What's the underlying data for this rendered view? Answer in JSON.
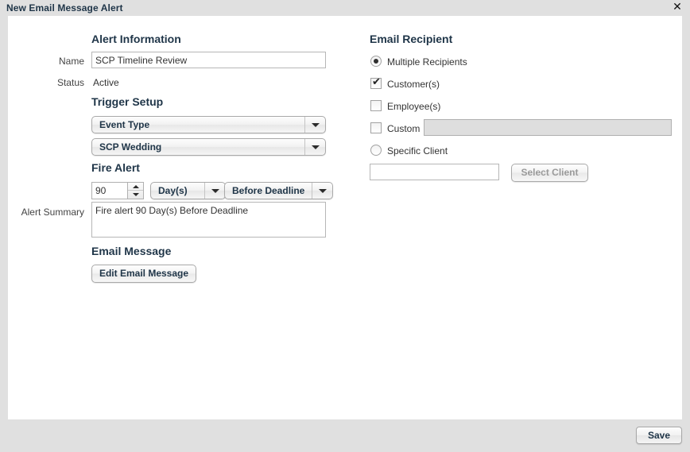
{
  "window": {
    "title": "New Email Message Alert",
    "close_icon": "close-icon"
  },
  "left_column": {
    "alert_information": {
      "heading": "Alert Information",
      "name_label": "Name",
      "name_value": "SCP Timeline Review",
      "status_label": "Status",
      "status_value": "Active"
    },
    "trigger_setup": {
      "heading": "Trigger Setup",
      "event_type_value": "Event Type",
      "event_name_value": "SCP Wedding"
    },
    "fire_alert": {
      "heading": "Fire Alert",
      "amount_value": "90",
      "unit_value": "Day(s)",
      "relation_value": "Before Deadline"
    },
    "alert_summary": {
      "label": "Alert Summary",
      "value": "Fire alert 90 Day(s) Before Deadline"
    },
    "email_message": {
      "heading": "Email Message",
      "edit_button": "Edit Email Message"
    }
  },
  "right_column": {
    "heading": "Email Recipient",
    "multiple_recipients_label": "Multiple Recipients",
    "multiple_recipients_selected": true,
    "customers_label": "Customer(s)",
    "customers_checked": true,
    "employees_label": "Employee(s)",
    "employees_checked": false,
    "custom_label": "Custom",
    "custom_checked": false,
    "custom_value": "",
    "specific_client_label": "Specific Client",
    "specific_client_selected": false,
    "client_value": "",
    "select_client_button": "Select Client"
  },
  "footer": {
    "save_label": "Save"
  }
}
